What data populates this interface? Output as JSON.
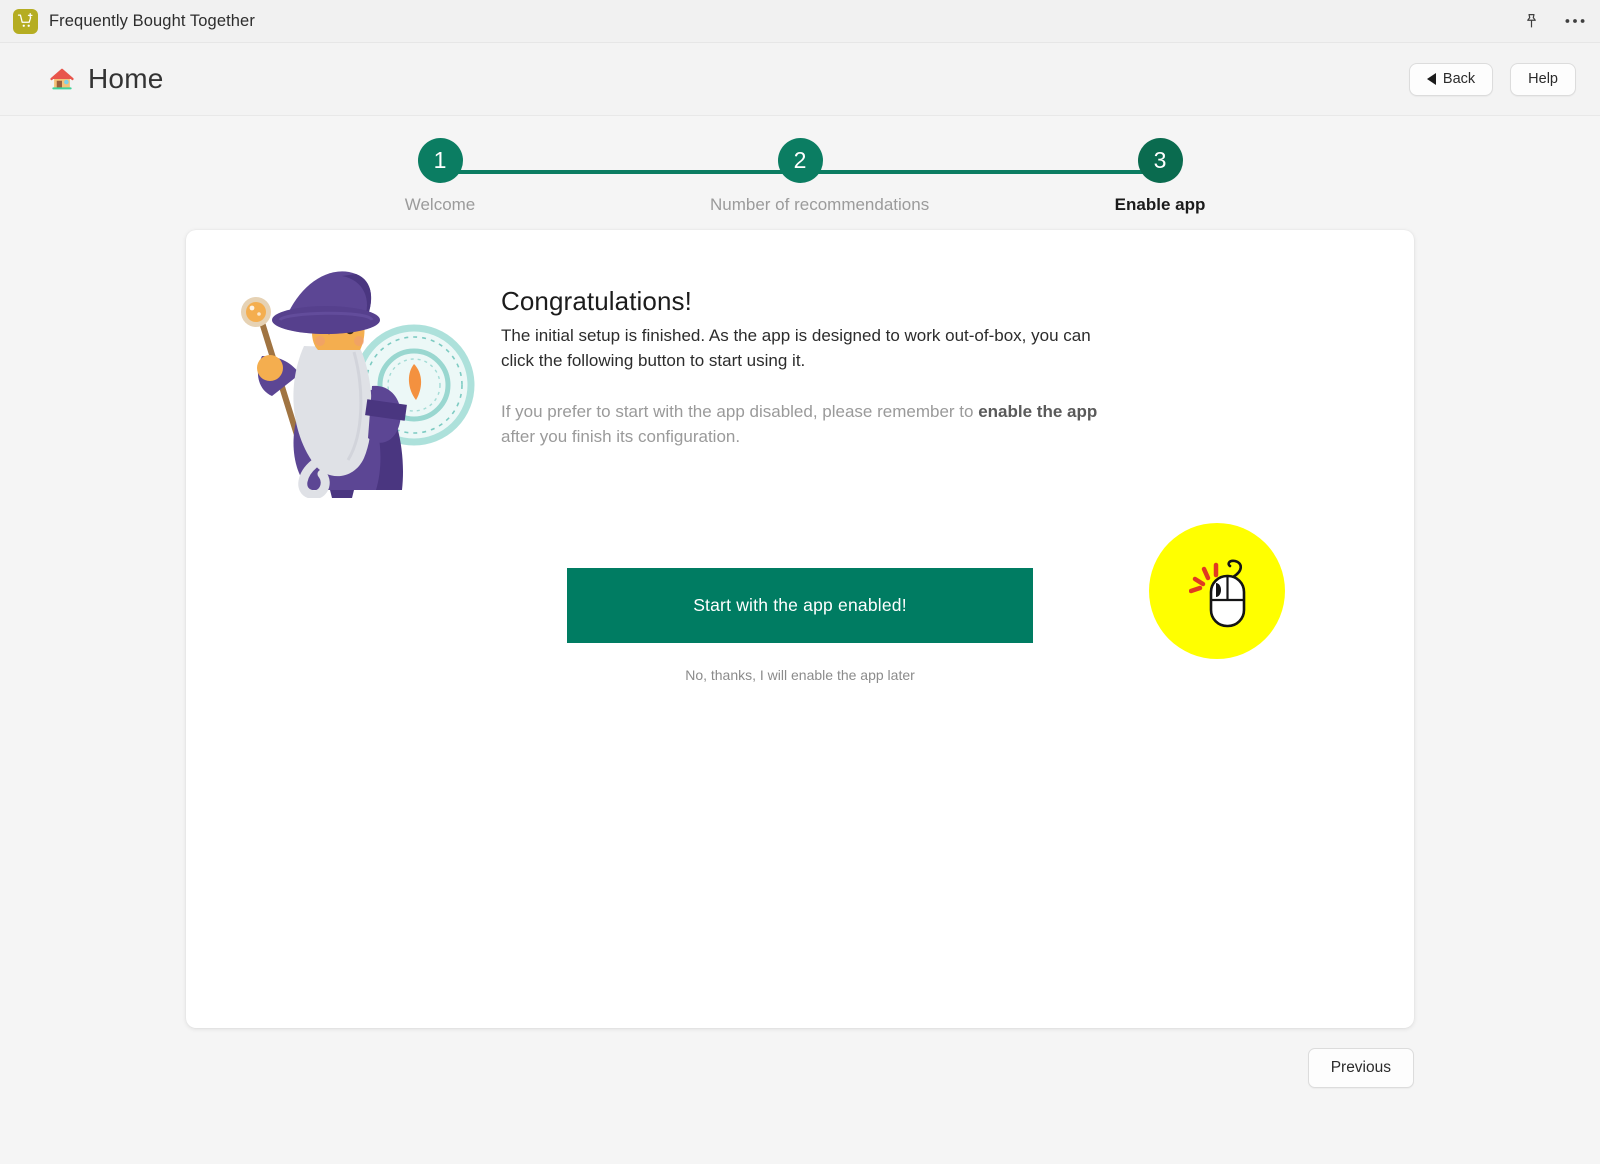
{
  "window": {
    "app_icon": "shopping-cart-plus-icon",
    "title": "Frequently Bought Together",
    "pin_icon": "pin-icon",
    "more_icon": "ellipsis-icon"
  },
  "header": {
    "home_icon": "house-icon",
    "title": "Home",
    "back_label": "Back",
    "help_label": "Help"
  },
  "stepper": {
    "steps": [
      {
        "number": "1",
        "label": "Welcome",
        "state": "done"
      },
      {
        "number": "2",
        "label": "Number of recommendations",
        "state": "done"
      },
      {
        "number": "3",
        "label": "Enable app",
        "state": "current"
      }
    ],
    "line_color": "#0b7d62",
    "bubble_color": "#0b7d62",
    "current_bubble_color": "#0a6b4f"
  },
  "card": {
    "illustration": "wizard-illustration",
    "heading": "Congratulations!",
    "body_text": "The initial setup is finished. As the app is designed to work out-of-box, you can click the following button to start using it.",
    "note_prefix": "If you prefer to start with the app disabled, please remember to ",
    "note_bold": "enable the app",
    "note_suffix": " after you finish its configuration.",
    "primary_button": "Start with the app enabled!",
    "secondary_link": "No, thanks, I will enable the app later",
    "primary_button_color": "#007c62"
  },
  "overlay": {
    "click_highlight_color": "#ffff00",
    "cursor_icon": "mouse-click-cursor"
  },
  "footer": {
    "previous_label": "Previous"
  }
}
